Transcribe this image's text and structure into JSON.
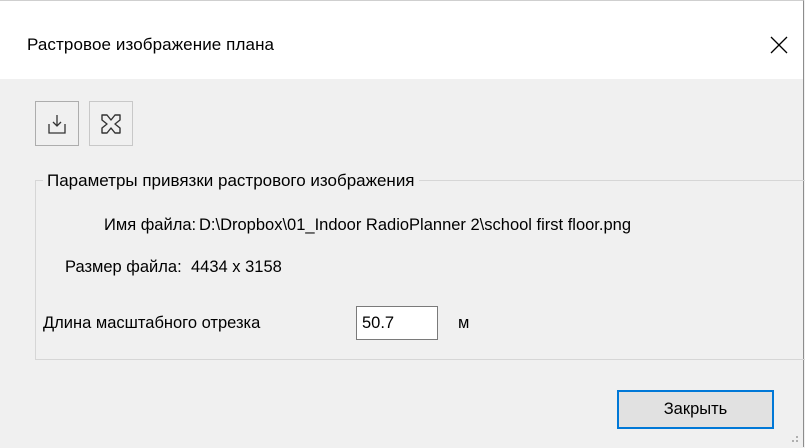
{
  "window": {
    "title": "Растровое изображение плана",
    "close_glyph": "✕"
  },
  "toolbar": {
    "load_icon": "import-icon",
    "remove_icon": "delete-image-icon"
  },
  "group": {
    "legend": "Параметры привязки растрового изображения",
    "file_name_label": "Имя файла:",
    "file_name_value": "D:\\Dropbox\\01_Indoor RadioPlanner 2\\school first floor.png",
    "file_size_label": "Размер файла:",
    "file_size_value": "4434 x 3158",
    "scale_label": "Длина масштабного отрезка",
    "scale_value": "50.7",
    "scale_unit": "м"
  },
  "footer": {
    "close_label": "Закрыть"
  }
}
